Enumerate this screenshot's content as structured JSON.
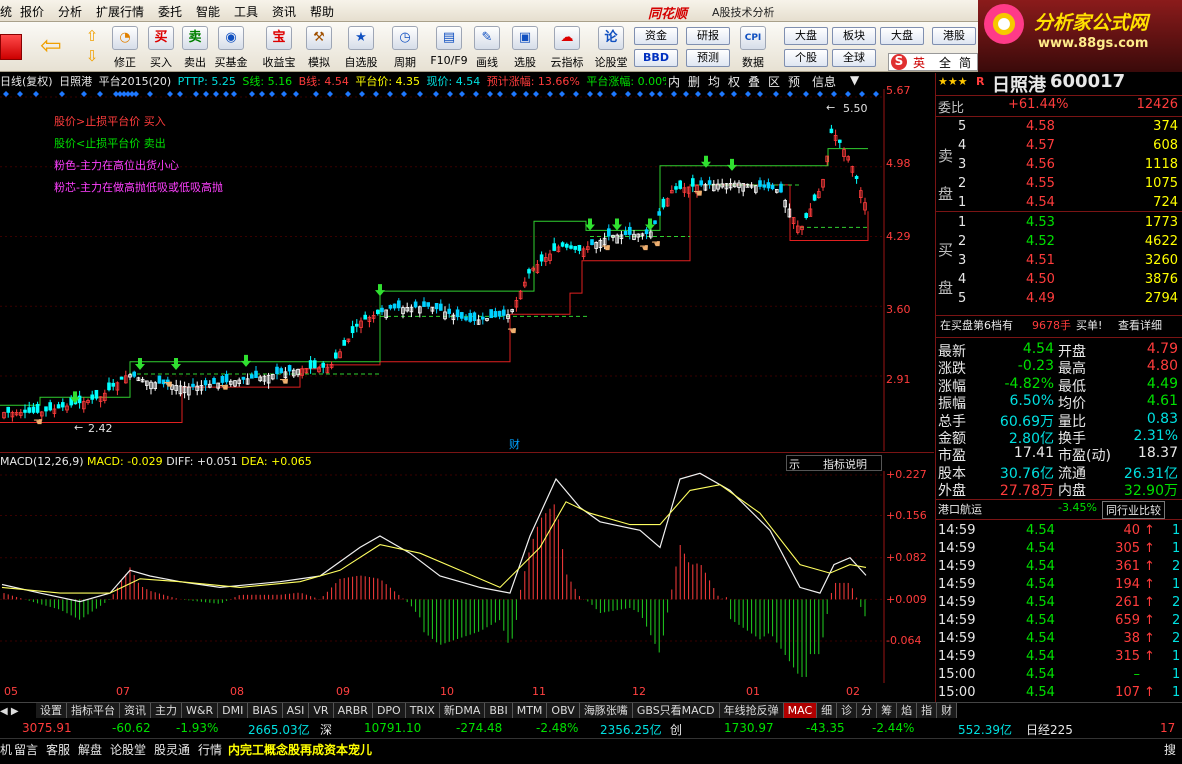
{
  "menu": [
    "统",
    "报价",
    "分析",
    "扩展行情",
    "委托",
    "智能",
    "工具",
    "资讯",
    "帮助"
  ],
  "app": {
    "brand": "同花顺",
    "title": "A股技术分析"
  },
  "logo": {
    "text": "分析家公式网",
    "url": "www.88gs.com"
  },
  "toolbar": {
    "items": [
      "修正",
      "买入",
      "卖出",
      "买基金",
      "收益宝",
      "模拟",
      "自选股",
      "周期",
      "F10/F9",
      "画线",
      "选股",
      "云指标",
      "论股堂"
    ],
    "small_buttons": [
      "资金",
      "研报",
      "大盘",
      "板块",
      "大盘",
      "港股",
      "BBD",
      "预测",
      "个股",
      "全球",
      "数据"
    ],
    "ime": [
      "英",
      "全",
      "简"
    ]
  },
  "stock": {
    "stars": "★★★",
    "name": "日照港",
    "code": "600017",
    "tag": "R"
  },
  "infobar": {
    "period": "日线(复权)",
    "name": "日照港",
    "indicator": "平台2015(20)",
    "pttp": "PTTP: 5.25",
    "s": "S线: 5.16",
    "b": "B线: 4.54",
    "plat": "平台价: 4.35",
    "cur": "现价: 4.54",
    "rise": "预计涨幅: 13.66%",
    "prise": "平台涨幅: 0.00%",
    "buttons": [
      "内",
      "删",
      "均",
      "权",
      "叠",
      "区",
      "预",
      "信息"
    ]
  },
  "chart_legend": [
    {
      "text": "股价>止损平台价   买入",
      "color": "#ff3c3c"
    },
    {
      "text": "股价<止损平台价   卖出",
      "color": "#00e000"
    },
    {
      "text": "粉色-主力在高位出货小心",
      "color": "#ff40ff"
    },
    {
      "text": "粉芯-主力在做高抛低吸或低吸高抛",
      "color": "#ff40ff"
    }
  ],
  "y_ticks": [
    "5.67",
    "4.98",
    "4.29",
    "3.60",
    "2.91"
  ],
  "annotations": {
    "high": "5.50",
    "low": "2.42",
    "cai": "财"
  },
  "macd": {
    "title": "MACD(12,26,9)",
    "macd": "MACD: -0.029",
    "diff": "DIFF: +0.051",
    "dea": "DEA: +0.065",
    "tab_left": "示",
    "tab": "指标说明",
    "ticks": [
      "+0.227",
      "+0.156",
      "+0.082",
      "+0.009",
      "-0.064"
    ]
  },
  "x_labels": [
    "05",
    "07",
    "08",
    "09",
    "10",
    "11",
    "12",
    "01",
    "02"
  ],
  "chart_data": {
    "type": "line",
    "y_ticks": [
      5.67,
      4.98,
      4.29,
      3.6,
      2.91
    ],
    "price_high": 5.5,
    "price_low": 2.42,
    "stop_platform": [
      2.62,
      2.62,
      2.62,
      2.62,
      3.05,
      3.05,
      3.05,
      3.05,
      3.05,
      3.05,
      3.05,
      3.05,
      3.05,
      3.05,
      3.05,
      3.05,
      3.05,
      3.05,
      3.05,
      3.05,
      3.05,
      3.05,
      3.05,
      3.05,
      3.05,
      3.05,
      3.05,
      3.05,
      3.05,
      3.05,
      3.05,
      3.05,
      3.05,
      3.05,
      3.05,
      3.05,
      3.05,
      3.05,
      3.05,
      3.71,
      3.71,
      3.71,
      3.71,
      3.71,
      3.71,
      3.71,
      3.71,
      3.71,
      3.71,
      3.71,
      3.71,
      3.71,
      3.71,
      3.71,
      3.71,
      3.71,
      3.71,
      3.71,
      3.71,
      3.71,
      3.71,
      3.71,
      3.71,
      3.71,
      3.71,
      3.71,
      3.71,
      3.71,
      3.71,
      3.71,
      3.71,
      3.71,
      3.71,
      3.71,
      3.71,
      3.71,
      3.71,
      3.71,
      3.71,
      3.71,
      3.71,
      3.71,
      3.71,
      3.71,
      3.71,
      3.71,
      3.71,
      3.71,
      3.71,
      3.71,
      3.71,
      3.71,
      3.71,
      3.71,
      3.71,
      3.71,
      3.71,
      3.71,
      3.71,
      3.71,
      3.71,
      3.71,
      3.71,
      3.71,
      3.71,
      3.71,
      3.71,
      3.71,
      3.71,
      3.71,
      3.71,
      3.71,
      3.71,
      3.71,
      3.71,
      3.71,
      3.71,
      3.71,
      3.71,
      3.71,
      3.71,
      3.71,
      3.71,
      3.71,
      3.71,
      3.71,
      3.71,
      3.71,
      3.71,
      3.71,
      3.71,
      3.71,
      3.71,
      3.71,
      3.71,
      3.71,
      3.71
    ],
    "macd_hist": [
      0.009,
      0.009,
      0.009,
      0.009,
      0.009
    ]
  },
  "rp": {
    "weibi_label": "委比",
    "weibi": "+61.44%",
    "weibi_n": "12426",
    "sell_label": "卖盘",
    "buy_label": "买盘",
    "sell": [
      [
        "5",
        "4.58",
        "374"
      ],
      [
        "4",
        "4.57",
        "608"
      ],
      [
        "3",
        "4.56",
        "1118"
      ],
      [
        "2",
        "4.55",
        "1075"
      ],
      [
        "1",
        "4.54",
        "724"
      ]
    ],
    "buy": [
      [
        "1",
        "4.53",
        "1773"
      ],
      [
        "2",
        "4.52",
        "4622"
      ],
      [
        "3",
        "4.51",
        "3260"
      ],
      [
        "4",
        "4.50",
        "3876"
      ],
      [
        "5",
        "4.49",
        "2794"
      ]
    ],
    "notice1": "在买盘第6档有",
    "notice2": "9678手",
    "notice3": "买单!",
    "notice4": "查看详细",
    "stats": [
      [
        "最新",
        "4.54",
        "开盘",
        "4.79"
      ],
      [
        "涨跌",
        "-0.23",
        "最高",
        "4.80"
      ],
      [
        "涨幅",
        "-4.82%",
        "最低",
        "4.49"
      ],
      [
        "振幅",
        "6.50%",
        "均价",
        "4.61"
      ],
      [
        "总手",
        "60.69万",
        "量比",
        "0.83"
      ],
      [
        "金额",
        "2.80亿",
        "换手",
        "2.31%"
      ],
      [
        "市盈",
        "17.41",
        "市盈(动)",
        "18.37"
      ],
      [
        "股本",
        "30.76亿",
        "流通",
        "26.31亿"
      ],
      [
        "外盘",
        "27.78万",
        "内盘",
        "32.90万"
      ]
    ],
    "sector": "港口航运",
    "sector_chg": "-3.45%",
    "compare": "同行业比较",
    "ticks": [
      [
        "14:59",
        "4.54",
        "40",
        "↑",
        "1"
      ],
      [
        "14:59",
        "4.54",
        "305",
        "↑",
        "1"
      ],
      [
        "14:59",
        "4.54",
        "361",
        "↑",
        "2"
      ],
      [
        "14:59",
        "4.54",
        "194",
        "↑",
        "1"
      ],
      [
        "14:59",
        "4.54",
        "261",
        "↑",
        "2"
      ],
      [
        "14:59",
        "4.54",
        "659",
        "↑",
        "2"
      ],
      [
        "14:59",
        "4.54",
        "38",
        "↑",
        "2"
      ],
      [
        "14:59",
        "4.54",
        "315",
        "↑",
        "1"
      ],
      [
        "15:00",
        "4.54",
        "–",
        "",
        "1"
      ],
      [
        "15:00",
        "4.54",
        "107",
        "↑",
        "1"
      ]
    ]
  },
  "tabs": [
    "设置",
    "指标平台",
    "资讯",
    "主力",
    "W&R",
    "DMI",
    "BIAS",
    "ASI",
    "VR",
    "ARBR",
    "DPO",
    "TRIX",
    "新DMA",
    "BBI",
    "MTM",
    "OBV",
    "海豚张嘴",
    "GBS只看MACD",
    "年线抢反弹",
    "MAC",
    "细",
    "诊",
    "分",
    "筹",
    "焰",
    "指",
    "财"
  ],
  "indexbar": {
    "v1": "3075.91",
    "c1": "-60.62",
    "p1": "-1.93%",
    "a1": "2665.03亿",
    "n2": "深",
    "v2": "10791.10",
    "c2": "-274.48",
    "p2": "-2.48%",
    "a2": "2356.25亿",
    "n3": "创",
    "v3": "1730.97",
    "c3": "-43.35",
    "p3": "-2.44%",
    "a3": "552.39亿",
    "n4": "日经225",
    "v4": "17"
  },
  "status": {
    "items": [
      "机",
      "留言",
      "客服",
      "解盘",
      "论股堂",
      "股灵通",
      "行情"
    ],
    "ticker": "内完工概念股再成资本宠儿",
    "right": "搜"
  }
}
